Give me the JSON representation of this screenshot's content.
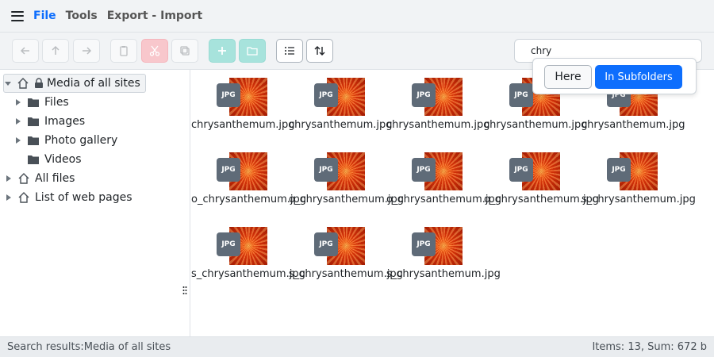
{
  "menu": {
    "items": [
      "File",
      "Tools",
      "Export - Import"
    ]
  },
  "toolbar": {
    "buttons": [
      "back-icon",
      "up-icon",
      "forward-icon",
      "paste-icon",
      "cut-icon",
      "copy-icon",
      "add-icon",
      "new-folder-icon",
      "list-view-icon",
      "sort-icon"
    ]
  },
  "search": {
    "value": "chry",
    "popup": {
      "here_label": "Here",
      "subfolders_label": "In Subfolders"
    }
  },
  "tree": {
    "root": "Media of all sites",
    "children": [
      "Files",
      "Images",
      "Photo gallery",
      "Videos"
    ],
    "top": [
      "All files",
      "List of web pages"
    ]
  },
  "files": [
    {
      "type": "JPG",
      "name": "chrysanthemum.jpg"
    },
    {
      "type": "JPG",
      "name": "chrysanthemum.jpg"
    },
    {
      "type": "JPG",
      "name": "chrysanthemum.jpg"
    },
    {
      "type": "JPG",
      "name": "chrysanthemum.jpg"
    },
    {
      "type": "JPG",
      "name": "chrysanthemum.jpg"
    },
    {
      "type": "JPG",
      "name": "o_chrysanthemum.jpg"
    },
    {
      "type": "JPG",
      "name": "o_chrysanthemum.jpg"
    },
    {
      "type": "JPG",
      "name": "o_chrysanthemum.jpg"
    },
    {
      "type": "JPG",
      "name": "o_chrysanthemum.jpg"
    },
    {
      "type": "JPG",
      "name": "s_chrysanthemum.jpg"
    },
    {
      "type": "JPG",
      "name": "s_chrysanthemum.jpg"
    },
    {
      "type": "JPG",
      "name": "s_chrysanthemum.jpg"
    },
    {
      "type": "JPG",
      "name": "s_chrysanthemum.jpg"
    }
  ],
  "status": {
    "left": "Search results:Media of all sites",
    "right": "Items: 13, Sum: 672 b"
  },
  "colors": {
    "accent": "#0d6efd",
    "cut": "#f8c7cc",
    "add": "#a7e3dc",
    "badge": "#5f6b78"
  }
}
